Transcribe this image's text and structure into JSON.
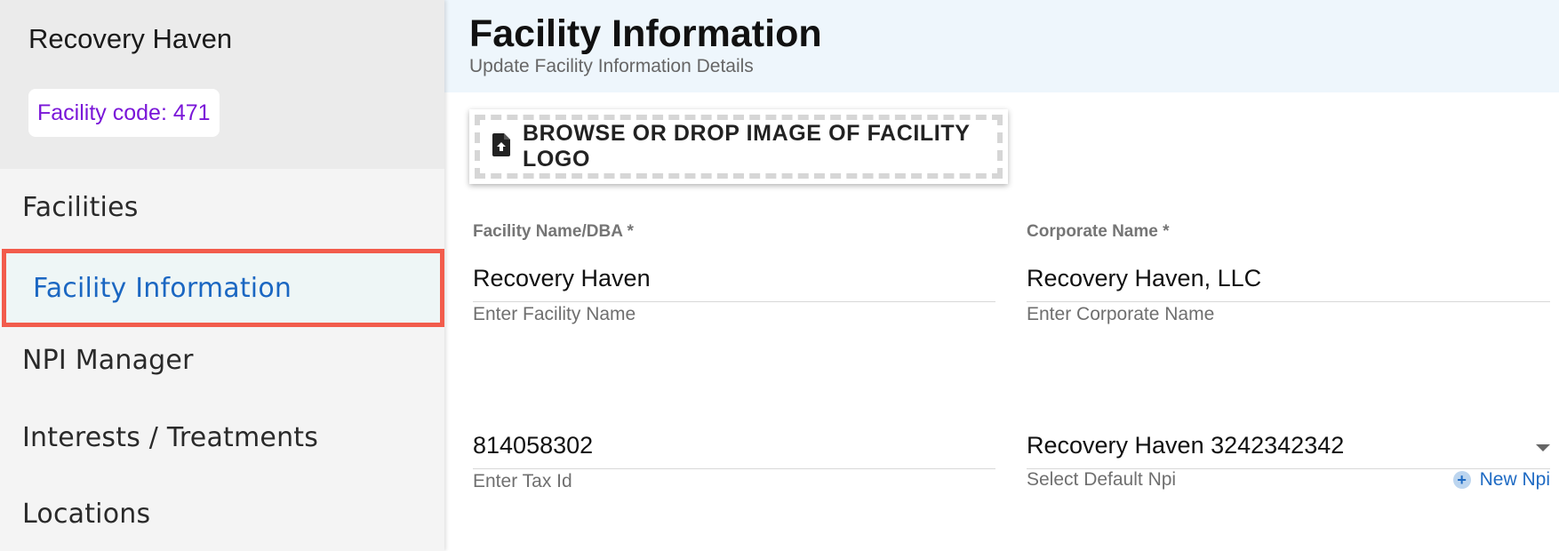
{
  "sidebar": {
    "facility_name": "Recovery Haven",
    "facility_code": "Facility code: 471",
    "items": [
      {
        "label": "Facilities"
      },
      {
        "label": "Facility Information"
      },
      {
        "label": "NPI Manager"
      },
      {
        "label": "Interests / Treatments"
      },
      {
        "label": "Locations"
      }
    ],
    "active_item": "Facility Information"
  },
  "header": {
    "title": "Facility Information",
    "subtitle": "Update Facility Information Details"
  },
  "upload": {
    "label": "BROWSE OR DROP IMAGE OF FACILITY LOGO",
    "icon": "file-upload-icon"
  },
  "form": {
    "facility_name": {
      "label": "Facility Name/DBA *",
      "value": "Recovery Haven",
      "help": "Enter Facility Name"
    },
    "corporate_name": {
      "label": "Corporate Name *",
      "value": "Recovery Haven, LLC",
      "help": "Enter Corporate Name"
    },
    "tax_id": {
      "value": "814058302",
      "help": "Enter Tax Id"
    },
    "default_npi": {
      "value": "Recovery Haven 3242342342",
      "help": "Select Default Npi",
      "new_label": "New Npi"
    }
  },
  "colors": {
    "accent": "#1b67c2",
    "highlight_border": "#f25c4c",
    "facility_code": "#7a16d8",
    "header_bg": "#eef6fc"
  }
}
